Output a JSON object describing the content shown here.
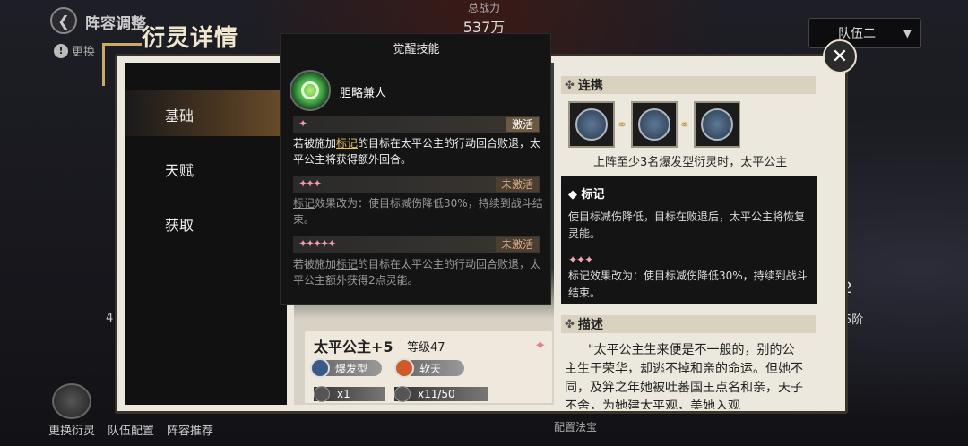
{
  "top_bar": {
    "back_label": "阵容调整",
    "replace_hint": "更换",
    "power_label": "总战力",
    "power_value": "537万",
    "team_select": "队伍二"
  },
  "bottom_nav": {
    "items": [
      "更换衍灵",
      "队伍配置",
      "阵容推荐"
    ],
    "config_label": "配置法宝"
  },
  "side_glimpses": {
    "right_num": "2",
    "right_rank": "5阶",
    "left_num": "4"
  },
  "modal": {
    "title": "衍灵详情",
    "nav": [
      "基础",
      "天赋",
      "获取"
    ],
    "close_icon": "close-icon"
  },
  "character": {
    "name": "太平公主+5",
    "level": "等级47",
    "tag_type": "爆发型",
    "tag_element": "软天",
    "count_1": "x1",
    "count_2": "x11/50"
  },
  "skill_panel": {
    "title": "觉醒技能",
    "skill_name": "胆略兼人",
    "tiers": [
      {
        "stars": "✦",
        "status": "激活",
        "pre": "若被施加",
        "keyword": "标记",
        "post": "的目标在太平公主的行动回合败退，太平公主将获得额外回合。"
      },
      {
        "stars": "✦✦✦",
        "status": "未激活",
        "keyword": "标记",
        "post": "效果改为：使目标减伤降低30%，持续到战斗结束。"
      },
      {
        "stars": "✦✦✦✦✦",
        "status": "未激活",
        "pre": "若被施加",
        "keyword": "标记",
        "post": "的目标在太平公主的行动回合败退，太平公主额外获得2点灵能。"
      }
    ]
  },
  "link_section": {
    "title": "连携",
    "text": "上阵至少3名爆发型衍灵时，太平公主"
  },
  "mark_tooltip": {
    "title": "标记",
    "desc": "使目标减伤降低，目标在败退后，太平公主将恢复灵能。",
    "stars": "✦✦✦",
    "effect": "标记效果改为：使目标减伤降低30%，持续到战斗结束。"
  },
  "desc_section": {
    "title": "描述",
    "text": "\"太平公主生来便是不一般的，别的公主生于荣华，却逃不掉和亲的命运。但她不同，及笄之年她被吐蕃国王点名和亲，天子不舍，为她建太平观，美她入观"
  }
}
